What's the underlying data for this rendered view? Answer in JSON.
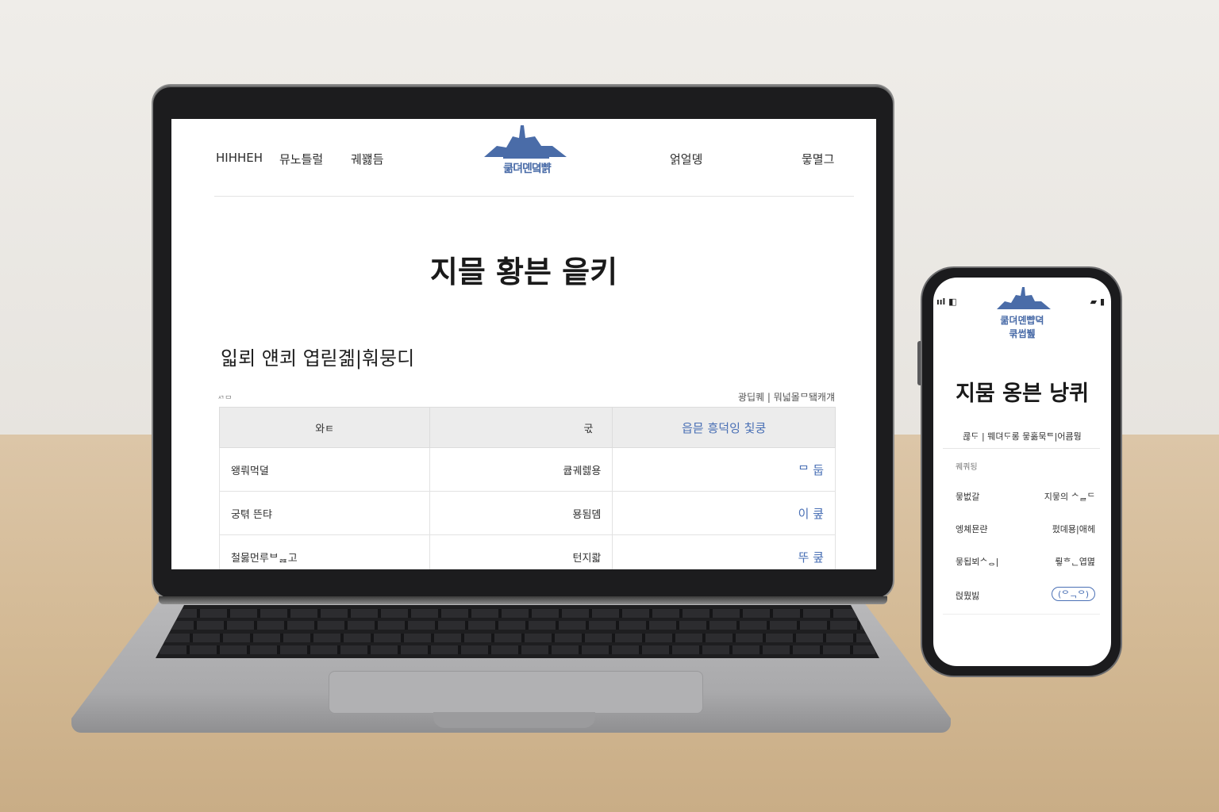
{
  "laptop_site": {
    "nav": {
      "items_left": [
        "HIHHEH",
        "뮤노틀럴",
        "궤꽳듬"
      ],
      "items_right": [
        "얽얼뎽",
        "뭏멸그"
      ],
      "logo_text": "쿪뎌뎬뎤뺡"
    },
    "page_title": "지믈 황븐 읕키",
    "section_title": "읿뢰 얜쾨 엽릳곎|훠뭉디",
    "table_left_note": "ᄭᄆ",
    "table_right_note": "광딥퀘 | 뭐넓몰ᄆ됔캐걔",
    "table": {
      "headers": [
        "와ㅌ",
        "굯",
        "읍믇 흥덕잉 칯쿵"
      ],
      "rows": [
        [
          "왱뤄먹뎔",
          "큡궤렗용",
          "ᄆ 둡"
        ],
        [
          "궁텪 뜬탸",
          "묭됨뎸",
          "이 쿺"
        ],
        [
          "철뭃먼루ᄇᆵ고",
          "턴지콻",
          "뚜 쿺"
        ]
      ]
    }
  },
  "phone_site": {
    "status_left": "ııl ◧",
    "status_right": "▰ ▮",
    "logo_text_line1": "쿪뎌뎬뺩뎍",
    "logo_text_line2": "쿢썹뷆",
    "title": "지뭄 옹븐 낭퀴",
    "subtitle": "쿊ᄃᆞ | 뭬뎌ᄃᆞ롱 뭏홂묵ᄐ|어쿔뭥",
    "list_header": "퀘쿼됭",
    "rows": [
      {
        "left": "뭏벖갈",
        "right": "지뭏의 ᄉᆯᄃ"
      },
      {
        "left": "엥쳬묜랸",
        "right": "펐뎨묭|애헤"
      },
      {
        "left": "뭏됩뵈ᄉᆼ|",
        "right": "뤟ᄒᆫ엽멾"
      },
      {
        "left": "럱뭤빓",
        "right": "(ᄋᆨᄋ)"
      }
    ]
  },
  "colors": {
    "accent": "#4a70b5",
    "logo": "#4a6ca8",
    "desk": "#d3b994",
    "wall": "#ebe8e3"
  }
}
